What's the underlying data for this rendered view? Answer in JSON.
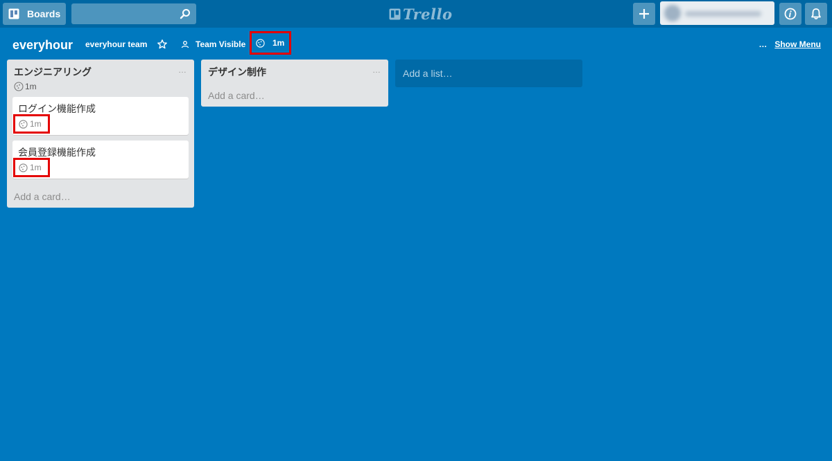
{
  "header": {
    "boards_label": "Boards",
    "search_value": "",
    "logo_text": "Trello",
    "add_icon": "plus-icon",
    "info_icon": "info-icon",
    "bell_icon": "bell-icon"
  },
  "board": {
    "title": "everyhour",
    "team": "everyhour team",
    "visibility": "Team Visible",
    "timer_total": "1m",
    "menu_dots": "…",
    "show_menu": "Show Menu"
  },
  "lists": [
    {
      "title": "エンジニアリング",
      "menu": "…",
      "timer": "1m",
      "cards": [
        {
          "title": "ログイン機能作成",
          "timer": "1m"
        },
        {
          "title": "会員登録機能作成",
          "timer": "1m"
        }
      ],
      "add_card": "Add a card…"
    },
    {
      "title": "デザイン制作",
      "menu": "…",
      "add_card": "Add a card…"
    }
  ],
  "add_list": "Add a list…",
  "colors": {
    "board_bg": "#0079bf",
    "header_bg": "#0067a3",
    "list_bg": "#e2e4e6",
    "highlight": "#e40000"
  }
}
